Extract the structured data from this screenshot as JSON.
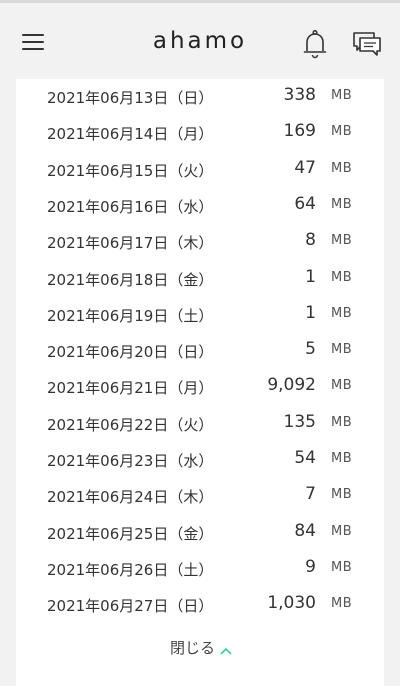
{
  "header": {
    "logo": "ahamo",
    "menu_icon": "hamburger-menu-icon",
    "bell_icon": "bell-icon",
    "chat_icon": "chat-icon"
  },
  "usage": {
    "unit": "MB",
    "rows": [
      {
        "date": "2021年06月13日（日）",
        "value": "338"
      },
      {
        "date": "2021年06月14日（月）",
        "value": "169"
      },
      {
        "date": "2021年06月15日（火）",
        "value": "47"
      },
      {
        "date": "2021年06月16日（水）",
        "value": "64"
      },
      {
        "date": "2021年06月17日（木）",
        "value": "8"
      },
      {
        "date": "2021年06月18日（金）",
        "value": "1"
      },
      {
        "date": "2021年06月19日（土）",
        "value": "1"
      },
      {
        "date": "2021年06月20日（日）",
        "value": "5"
      },
      {
        "date": "2021年06月21日（月）",
        "value": "9,092"
      },
      {
        "date": "2021年06月22日（火）",
        "value": "135"
      },
      {
        "date": "2021年06月23日（水）",
        "value": "54"
      },
      {
        "date": "2021年06月24日（木）",
        "value": "7"
      },
      {
        "date": "2021年06月25日（金）",
        "value": "84"
      },
      {
        "date": "2021年06月26日（土）",
        "value": "9"
      },
      {
        "date": "2021年06月27日（日）",
        "value": "1,030"
      }
    ],
    "close_label": "閉じる",
    "accent_color": "#3cc8a0"
  }
}
